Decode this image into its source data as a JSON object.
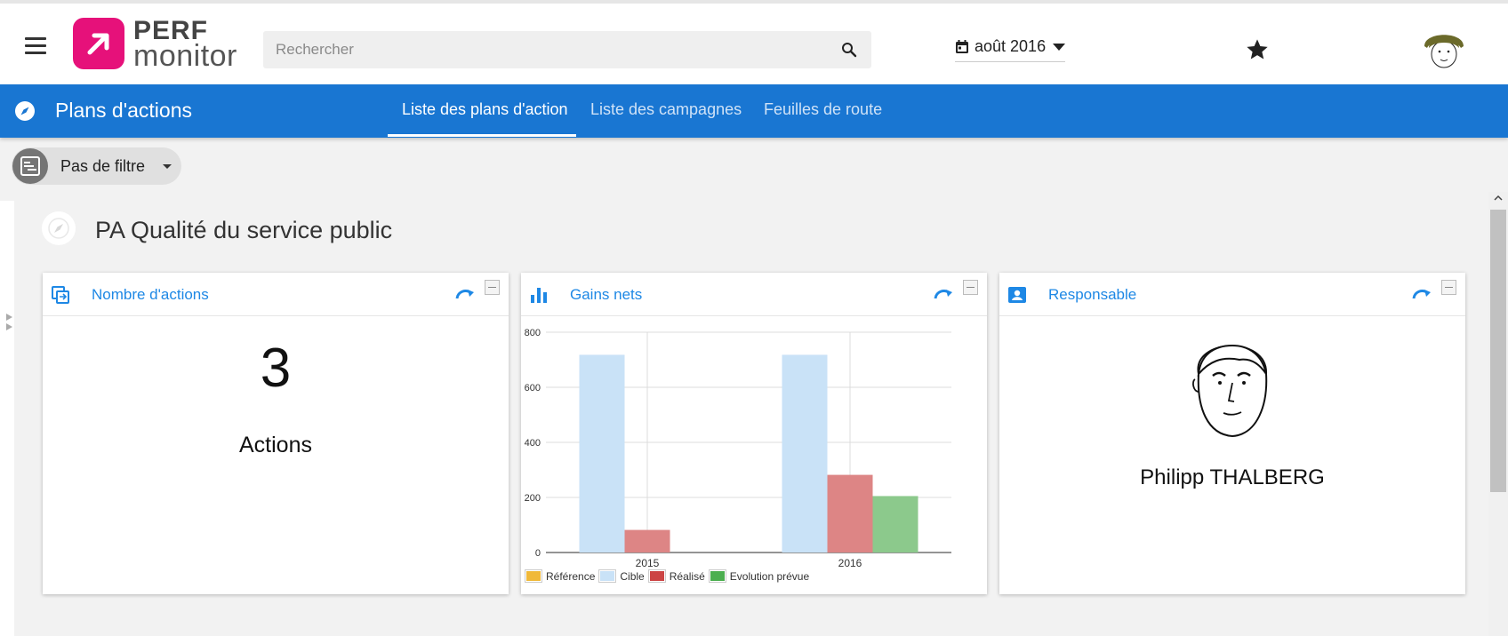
{
  "header": {
    "logo": {
      "line1": "PERF",
      "line2": "monitor",
      "color": "#e6117a"
    },
    "search": {
      "placeholder": "Rechercher",
      "value": ""
    },
    "date": "août 2016"
  },
  "nav": {
    "title": "Plans d'actions",
    "color": "#1976d2",
    "tabs": [
      {
        "label": "Liste des plans d'action",
        "active": true
      },
      {
        "label": "Liste des campagnes",
        "active": false
      },
      {
        "label": "Feuilles de route",
        "active": false
      }
    ]
  },
  "filter": {
    "label": "Pas de filtre"
  },
  "section": {
    "title": "PA Qualité du service public"
  },
  "cards": {
    "actions": {
      "title": "Nombre d'actions",
      "value": "3",
      "unit": "Actions"
    },
    "gains": {
      "title": "Gains nets"
    },
    "responsable": {
      "title": "Responsable",
      "name": "Philipp THALBERG"
    }
  },
  "chart_data": {
    "type": "bar",
    "categories": [
      "2015",
      "2016"
    ],
    "ylim": [
      0,
      800
    ],
    "yticks": [
      0,
      200,
      400,
      600,
      800
    ],
    "series": [
      {
        "name": "Référence",
        "color": "#f0b93a",
        "values": [
          0,
          0
        ]
      },
      {
        "name": "Cible",
        "color": "#c9e2f7",
        "values": [
          718,
          718
        ]
      },
      {
        "name": "Réalisé",
        "color": "#dd8585",
        "values": [
          82,
          282
        ]
      },
      {
        "name": "Evolution prévue",
        "color": "#8cc98c",
        "values": [
          0,
          205
        ]
      }
    ],
    "legend_colors": [
      "#f0b93a",
      "#c9e2f7",
      "#cc4444",
      "#4caf50"
    ],
    "grid": true,
    "legend": "bottom"
  }
}
